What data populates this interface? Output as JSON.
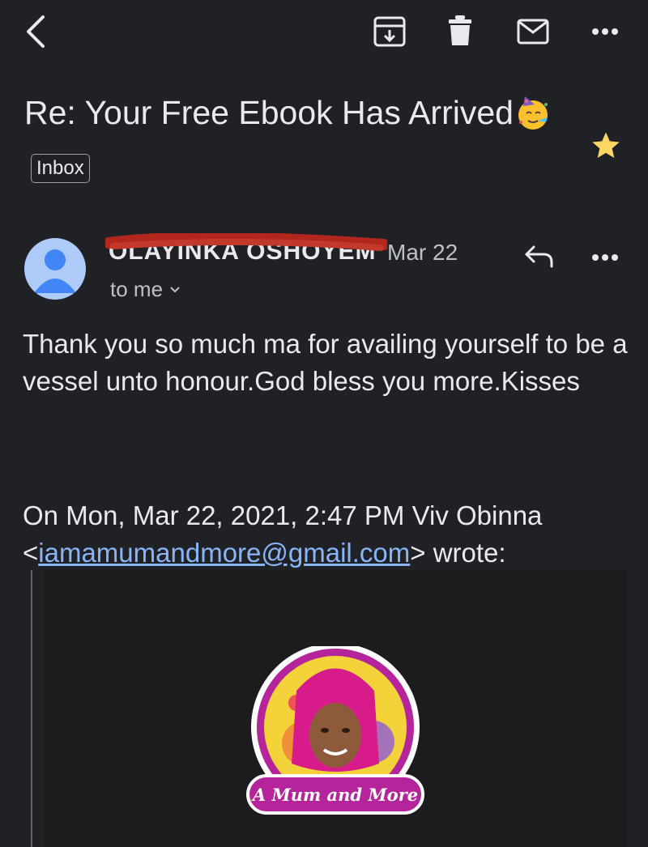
{
  "toolbar": {
    "back_icon": "chevron-left-icon",
    "archive_icon": "archive-icon",
    "delete_icon": "trash-icon",
    "mark_unread_icon": "mail-icon",
    "more_icon": "more-horizontal-icon"
  },
  "subject": {
    "text": "Re: Your Free Ebook Has Arrived",
    "emoji": "🥳",
    "label": "Inbox",
    "starred": true,
    "star_color": "#fdd663"
  },
  "message": {
    "sender_name": "OLAYINKA OSHOYEMI",
    "sender_redacted": true,
    "redaction_color": "#b3261e",
    "date": "Mar 22",
    "recipient": "to me",
    "body": "Thank you so much ma for availing yourself to be a vessel unto honour.God bless you more.Kisses"
  },
  "quoted": {
    "header_prefix": "On Mon, Mar 22, 2021, 2:47 PM Viv Obinna",
    "open_bracket": "<",
    "email": "iamamumandmore@gmail.com",
    "header_suffix": "> wrote:",
    "logo_text": "A Mum and More"
  },
  "colors": {
    "background": "#202124",
    "text": "#e8eaed",
    "secondary_text": "#bdc1c6",
    "link": "#8ab4f8",
    "avatar_bg": "#aecbfa",
    "avatar_fg": "#4285f4"
  }
}
